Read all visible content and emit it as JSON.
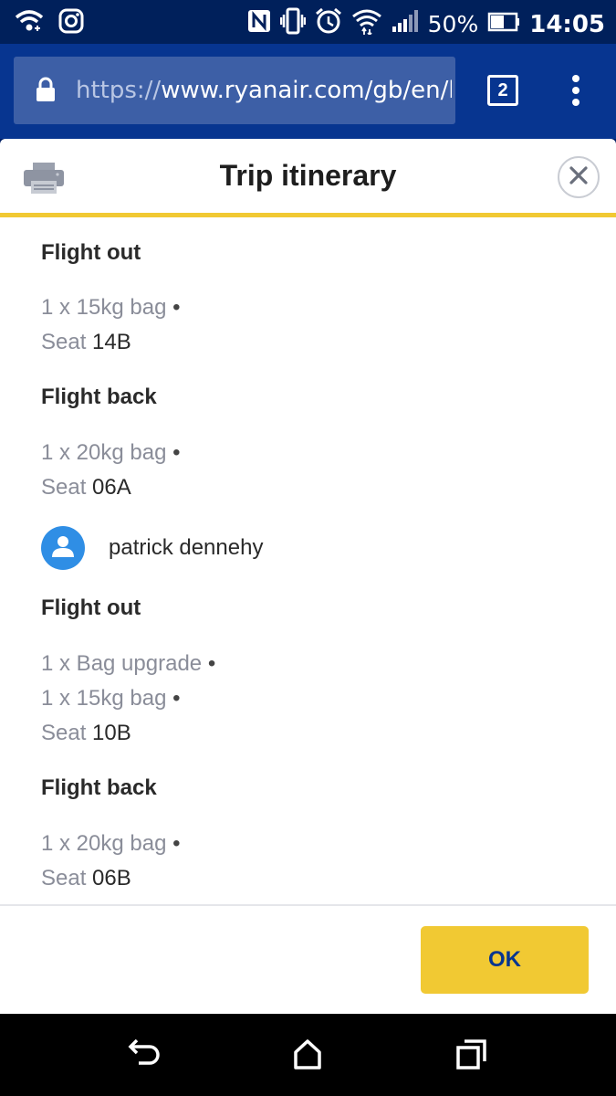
{
  "status_bar": {
    "battery_percent": "50%",
    "time": "14:05",
    "icons": [
      "wifi-call-icon",
      "instagram-icon",
      "nfc-icon",
      "vibrate-icon",
      "alarm-icon",
      "wifi-icon",
      "signal-icon",
      "battery-icon"
    ]
  },
  "browser": {
    "url_protocol": "https://",
    "url_rest": "www.ryanair.com/gb/en/boo",
    "tab_count": "2"
  },
  "modal": {
    "title": "Trip itinerary",
    "ok_label": "OK",
    "passengers": [
      {
        "name": "",
        "flights": [
          {
            "heading": "Flight out",
            "items": [
              {
                "text": "1 x 15kg bag",
                "bullet": "•"
              },
              {
                "label": "Seat",
                "value": "14B"
              }
            ]
          },
          {
            "heading": "Flight back",
            "items": [
              {
                "text": "1 x 20kg bag",
                "bullet": "•"
              },
              {
                "label": "Seat",
                "value": "06A"
              }
            ]
          }
        ]
      },
      {
        "name": "patrick dennehy",
        "flights": [
          {
            "heading": "Flight out",
            "items": [
              {
                "text": "1 x Bag upgrade",
                "bullet": "•"
              },
              {
                "text": "1 x 15kg bag",
                "bullet": "•"
              },
              {
                "label": "Seat",
                "value": "10B"
              }
            ]
          },
          {
            "heading": "Flight back",
            "items": [
              {
                "text": "1 x 20kg bag",
                "bullet": "•"
              },
              {
                "label": "Seat",
                "value": "06B"
              }
            ]
          }
        ]
      }
    ]
  },
  "colors": {
    "brand_navy": "#073590",
    "accent_yellow": "#f1c933",
    "avatar_blue": "#2f8ee5"
  }
}
